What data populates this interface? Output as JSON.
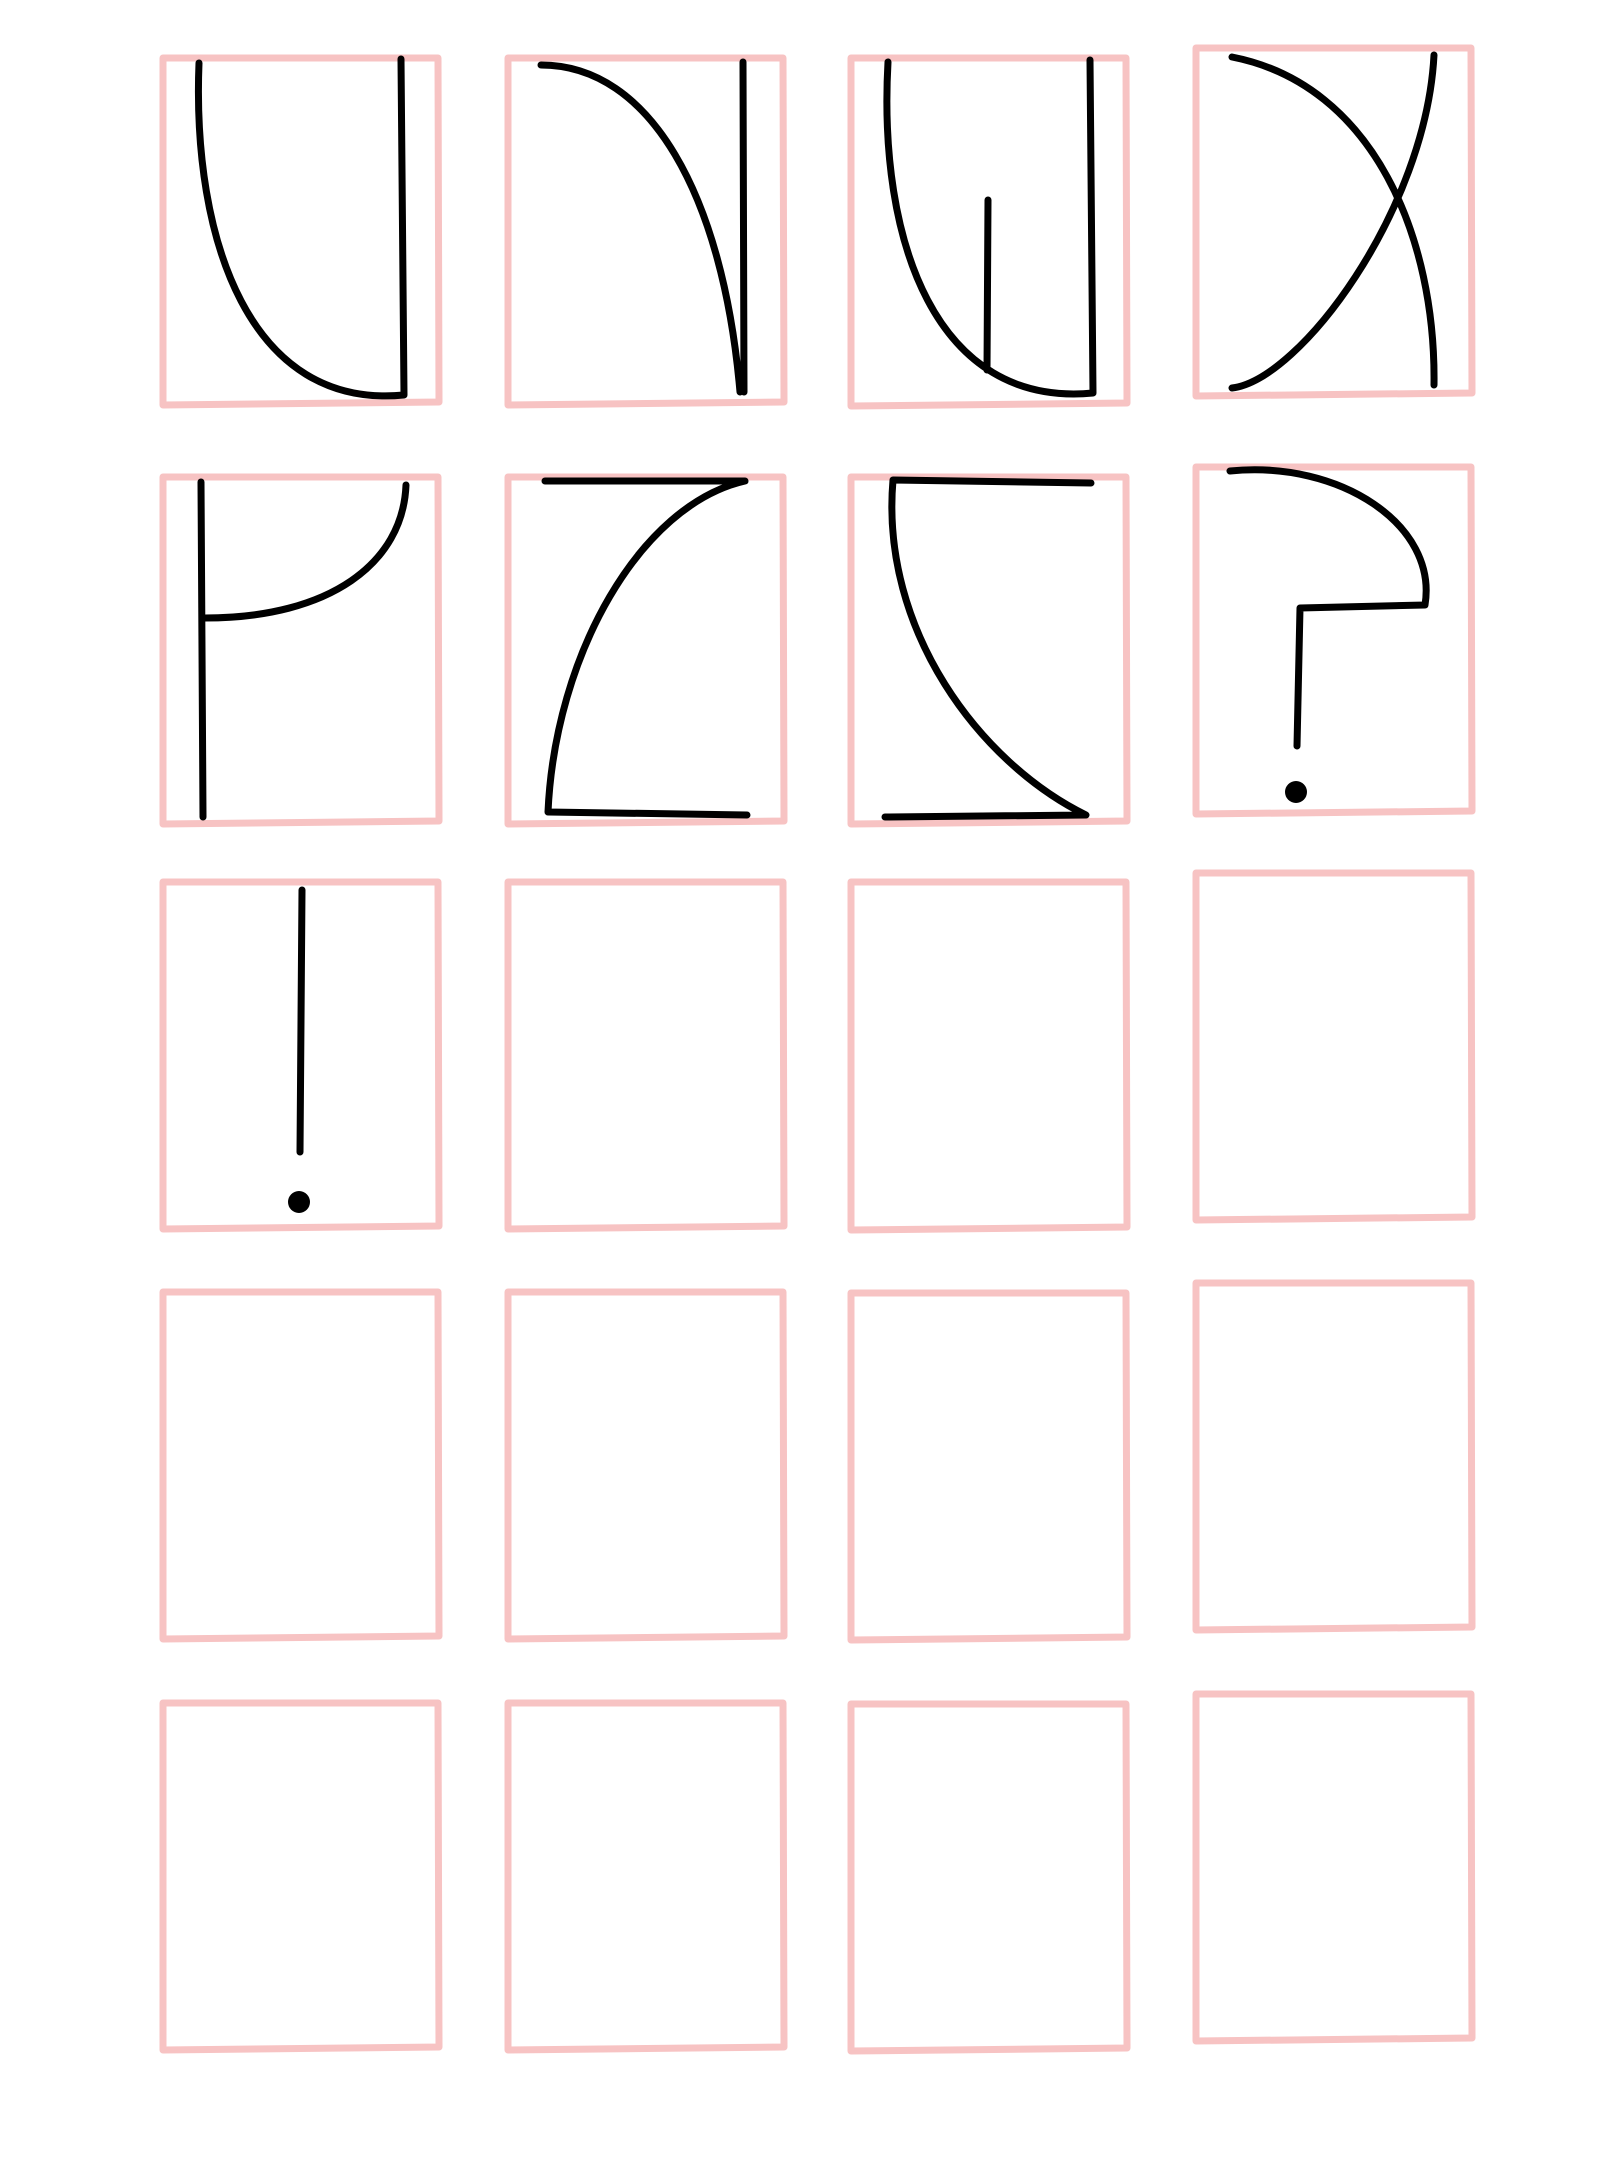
{
  "sheet": {
    "grid": {
      "rows": 5,
      "columns": 4
    },
    "colors": {
      "background": "#ffffff",
      "cell_outline": "#f7c3c3",
      "ink": "#000000"
    },
    "cells": [
      {
        "row": 1,
        "col": 1,
        "glyph": "u-shape-glyph",
        "filled": true
      },
      {
        "row": 1,
        "col": 2,
        "glyph": "n-curve-glyph",
        "filled": true
      },
      {
        "row": 1,
        "col": 3,
        "glyph": "w-shape-glyph",
        "filled": true
      },
      {
        "row": 1,
        "col": 4,
        "glyph": "x-cross-glyph",
        "filled": true
      },
      {
        "row": 2,
        "col": 1,
        "glyph": "p-hook-glyph",
        "filled": true
      },
      {
        "row": 2,
        "col": 2,
        "glyph": "z-curve-glyph",
        "filled": true
      },
      {
        "row": 2,
        "col": 3,
        "glyph": "s-curve-glyph",
        "filled": true
      },
      {
        "row": 2,
        "col": 4,
        "glyph": "question-mark-glyph",
        "filled": true
      },
      {
        "row": 3,
        "col": 1,
        "glyph": "exclamation-mark-glyph",
        "filled": true
      },
      {
        "row": 3,
        "col": 2,
        "glyph": null,
        "filled": false
      },
      {
        "row": 3,
        "col": 3,
        "glyph": null,
        "filled": false
      },
      {
        "row": 3,
        "col": 4,
        "glyph": null,
        "filled": false
      },
      {
        "row": 4,
        "col": 1,
        "glyph": null,
        "filled": false
      },
      {
        "row": 4,
        "col": 2,
        "glyph": null,
        "filled": false
      },
      {
        "row": 4,
        "col": 3,
        "glyph": null,
        "filled": false
      },
      {
        "row": 4,
        "col": 4,
        "glyph": null,
        "filled": false
      },
      {
        "row": 5,
        "col": 1,
        "glyph": null,
        "filled": false
      },
      {
        "row": 5,
        "col": 2,
        "glyph": null,
        "filled": false
      },
      {
        "row": 5,
        "col": 3,
        "glyph": null,
        "filled": false
      },
      {
        "row": 5,
        "col": 4,
        "glyph": null,
        "filled": false
      }
    ]
  }
}
